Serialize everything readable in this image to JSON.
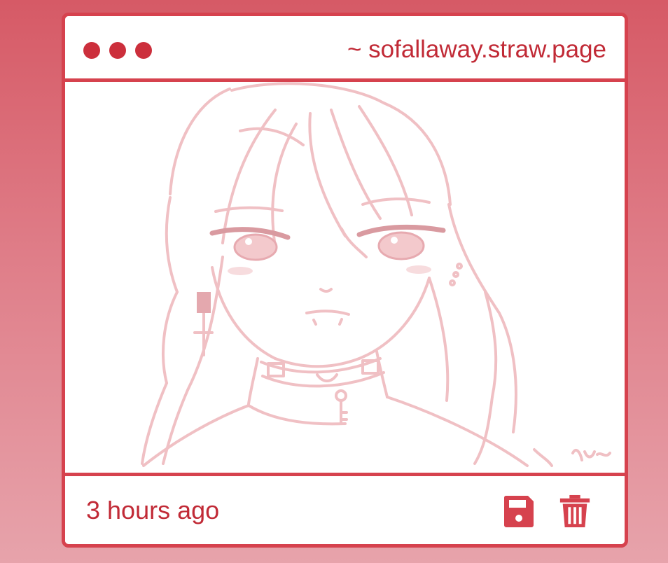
{
  "window": {
    "url": "~ sofallaway.straw.page"
  },
  "post": {
    "timestamp": "3 hours ago"
  },
  "icons": {
    "window_dots": [
      "window-dot-icon",
      "window-dot-icon",
      "window-dot-icon"
    ],
    "save": "floppy-disk-icon",
    "delete": "trash-icon"
  },
  "colors": {
    "accent": "#d6424e",
    "text": "#c12a36",
    "sketch_line": "#f0c0c4"
  }
}
